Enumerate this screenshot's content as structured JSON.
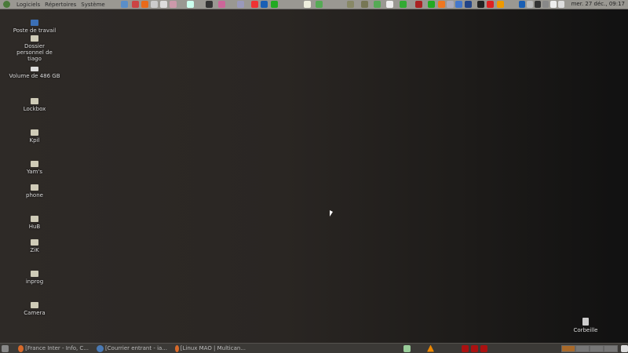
{
  "top_panel": {
    "menus": [
      "Logiciels",
      "Répertoires",
      "Système"
    ],
    "launchers": [
      {
        "icon": "web-browser-icon",
        "color": "#5a8ec8"
      },
      {
        "icon": "bug-icon",
        "color": "#c44"
      },
      {
        "icon": "firefox-icon",
        "color": "#e86a1a"
      },
      {
        "icon": "gimp-icon",
        "color": "#ccc"
      },
      {
        "icon": "printer-icon",
        "color": "#ddd"
      },
      {
        "icon": "media-player-icon",
        "color": "#c9a"
      },
      {
        "icon": "document-icon",
        "color": "#cfe"
      },
      {
        "icon": "terminal-icon",
        "color": "#333"
      },
      {
        "icon": "eye-icon",
        "color": "#c69"
      },
      {
        "icon": "microphone-icon",
        "color": "#99b"
      },
      {
        "icon": "pdf-icon",
        "color": "#e33"
      },
      {
        "icon": "hp-icon",
        "color": "#1a5fb4"
      },
      {
        "icon": "wireless-icon",
        "color": "#2a2"
      },
      {
        "icon": "weather-icon",
        "color": "#eed"
      },
      {
        "icon": "network-icon",
        "color": "#5a5"
      },
      {
        "icon": "tool-icon",
        "color": "#886"
      },
      {
        "icon": "coffee-icon",
        "color": "#775"
      },
      {
        "icon": "refresh-icon",
        "color": "#5a5"
      },
      {
        "icon": "panda-icon",
        "color": "#eee"
      },
      {
        "icon": "meter-icon",
        "color": "#3a3"
      },
      {
        "icon": "pulse-icon",
        "color": "#a22"
      },
      {
        "icon": "music-icon",
        "color": "#2a2"
      },
      {
        "icon": "drop-icon",
        "color": "#e72"
      },
      {
        "icon": "settings-icon",
        "color": "#aab"
      },
      {
        "icon": "calendar-icon",
        "color": "#47c"
      },
      {
        "icon": "monitor-icon",
        "color": "#248"
      },
      {
        "icon": "pen-icon",
        "color": "#222"
      },
      {
        "icon": "warning-icon",
        "color": "#d22"
      },
      {
        "icon": "headphones-icon",
        "color": "#e90"
      }
    ],
    "tray": [
      {
        "icon": "hp-tray-icon",
        "color": "#1a5fb4"
      },
      {
        "icon": "mic-tray-icon",
        "color": "#bbb"
      },
      {
        "icon": "battery-icon",
        "color": "#333"
      },
      {
        "icon": "volume-icon",
        "color": "#888"
      },
      {
        "icon": "key-icon",
        "color": "#eee"
      },
      {
        "icon": "user-icon",
        "color": "#ddd"
      }
    ],
    "clock": "mer. 27 déc., 09:17"
  },
  "desktop": {
    "icons": [
      {
        "label": "Poste de travail",
        "icon": "computer-icon"
      },
      {
        "label": "Dossier personnel de tiago",
        "icon": "home-folder-icon"
      },
      {
        "label": "Volume de 486 GB",
        "icon": "drive-icon"
      },
      {
        "label": "Lockbox",
        "icon": "folder-icon"
      },
      {
        "label": "Kpil",
        "icon": "folder-icon"
      },
      {
        "label": "Yam's",
        "icon": "folder-icon"
      },
      {
        "label": "phone",
        "icon": "folder-icon"
      },
      {
        "label": "HuB",
        "icon": "folder-icon"
      },
      {
        "label": "ZiK",
        "icon": "folder-icon"
      },
      {
        "label": "inprog",
        "icon": "folder-icon"
      },
      {
        "label": "Camera",
        "icon": "folder-icon"
      }
    ],
    "trash": "Corbeille"
  },
  "bottom_panel": {
    "tasks": [
      {
        "label": "[France Inter - Info, C...",
        "icon": "firefox-icon"
      },
      {
        "label": "[Courrier entrant - ia...",
        "icon": "thunderbird-icon"
      },
      {
        "label": "[Linux MAO | Multican...",
        "icon": "firefox-icon"
      }
    ],
    "workspaces": 4,
    "active_workspace": 1
  }
}
